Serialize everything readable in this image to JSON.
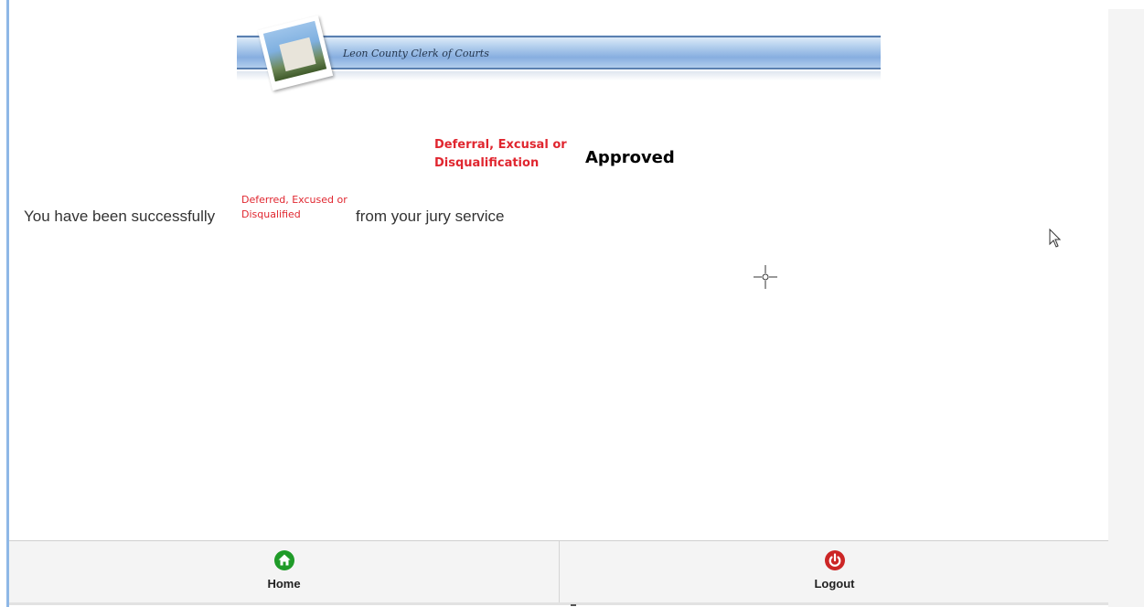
{
  "banner": {
    "title": "Leon County Clerk of Courts"
  },
  "heading": {
    "notice": "Deferral, Excusal or Disqualification",
    "status": "Approved"
  },
  "message": {
    "prefix": "You have been successfully",
    "note": "Deferred, Excused or Disqualified",
    "suffix": "from your jury service"
  },
  "footer": {
    "home": {
      "label": "Home",
      "icon": "home-icon",
      "color": "#1f9b28"
    },
    "logout": {
      "label": "Logout",
      "icon": "power-icon",
      "color": "#cc2626"
    }
  },
  "colors": {
    "accent_red": "#e0262f",
    "left_rule": "#8fb8e6"
  }
}
